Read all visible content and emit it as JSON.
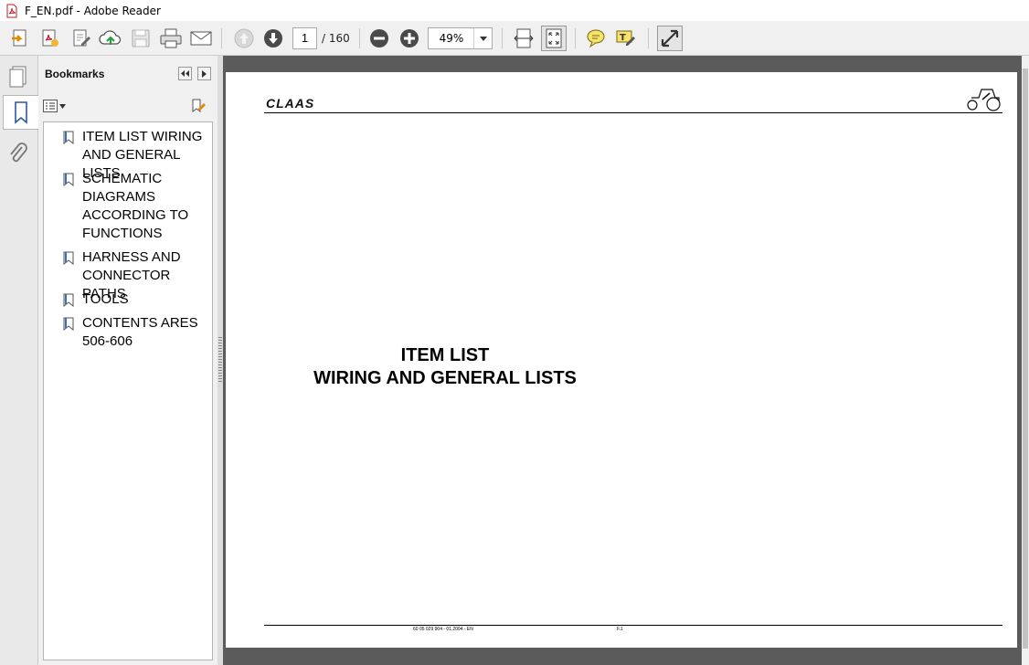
{
  "window": {
    "title": "F_EN.pdf - Adobe Reader"
  },
  "toolbar": {
    "page_current": "1",
    "page_total": "/ 160",
    "zoom": "49%"
  },
  "bookmarks_panel": {
    "title": "Bookmarks",
    "items": [
      {
        "label": "ITEM LIST WIRING AND GENERAL LISTS"
      },
      {
        "label": "SCHEMATIC DIAGRAMS ACCORDING TO FUNCTIONS"
      },
      {
        "label": "HARNESS AND CONNECTOR PATHS"
      },
      {
        "label": "TOOLS"
      },
      {
        "label": "CONTENTS ARES 506-606"
      }
    ]
  },
  "document": {
    "brand": "CLAAS",
    "title_line1": "ITEM LIST",
    "title_line2": "WIRING AND GENERAL LISTS",
    "footer_left": "60 05 029 904 - 01.2004 - EN",
    "footer_right": "F.1"
  },
  "colors": {
    "toolbar_bg": "#f0f0f0",
    "doc_bg": "#5b5b5b",
    "accent_pdf": "#c8102e",
    "icon_blue": "#3b6fb6"
  }
}
